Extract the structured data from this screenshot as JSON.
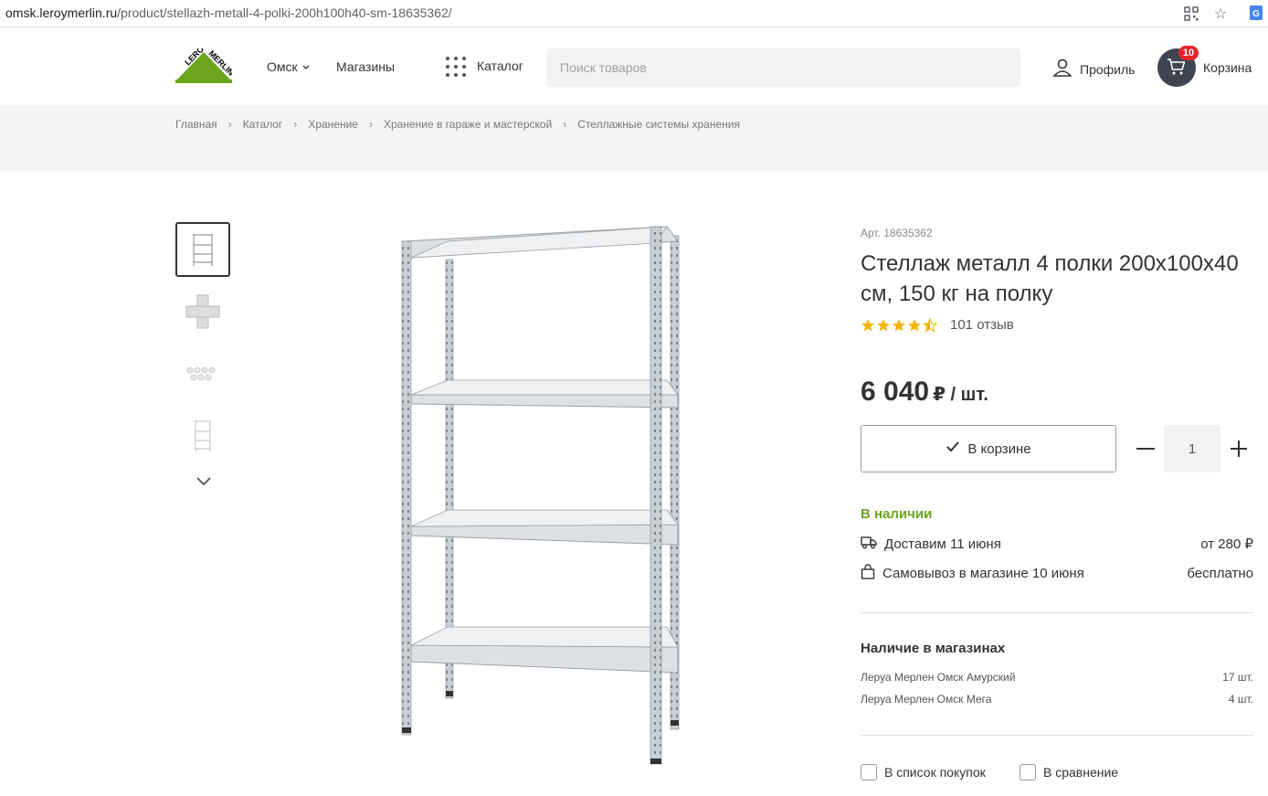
{
  "browser": {
    "url_domain": "omsk.leroymerlin.ru",
    "url_path": "/product/stellazh-metall-4-polki-200h100h40-sm-18635362/"
  },
  "header": {
    "logo_text": "LEROY MERLIN",
    "city": "Омск",
    "shops": "Магазины",
    "catalog": "Каталог",
    "search_placeholder": "Поиск товаров",
    "profile": "Профиль",
    "cart_label": "Корзина",
    "cart_count": "10"
  },
  "breadcrumbs": [
    "Главная",
    "Каталог",
    "Хранение",
    "Хранение в гараже и мастерской",
    "Стеллажные системы хранения"
  ],
  "product": {
    "article": "Арт. 18635362",
    "title": "Стеллаж металл 4 полки 200х100х40 см, 150 кг на полку",
    "rating": 4.5,
    "reviews": "101 отзыв",
    "price": "6 040",
    "price_unit": "₽ / шт.",
    "incart_label": "В корзине",
    "quantity": "1",
    "availability": "В наличии",
    "delivery_label": "Доставим 11 июня",
    "delivery_price": "от 280 ₽",
    "pickup_label": "Самовывоз в магазине 10 июня",
    "pickup_price": "бесплатно",
    "stores_title": "Наличие в магазинах",
    "stores": [
      {
        "name": "Леруа Мерлен Омск Амурский",
        "qty": "17 шт."
      },
      {
        "name": "Леруа Мерлен Омск Мега",
        "qty": "4 шт."
      }
    ],
    "shopping_list": "В список покупок",
    "compare": "В сравнение"
  },
  "colors": {
    "brand_green": "#6aa51f",
    "cart_dark": "#3e4450",
    "badge_red": "#e5262b",
    "star": "#f5b400"
  }
}
